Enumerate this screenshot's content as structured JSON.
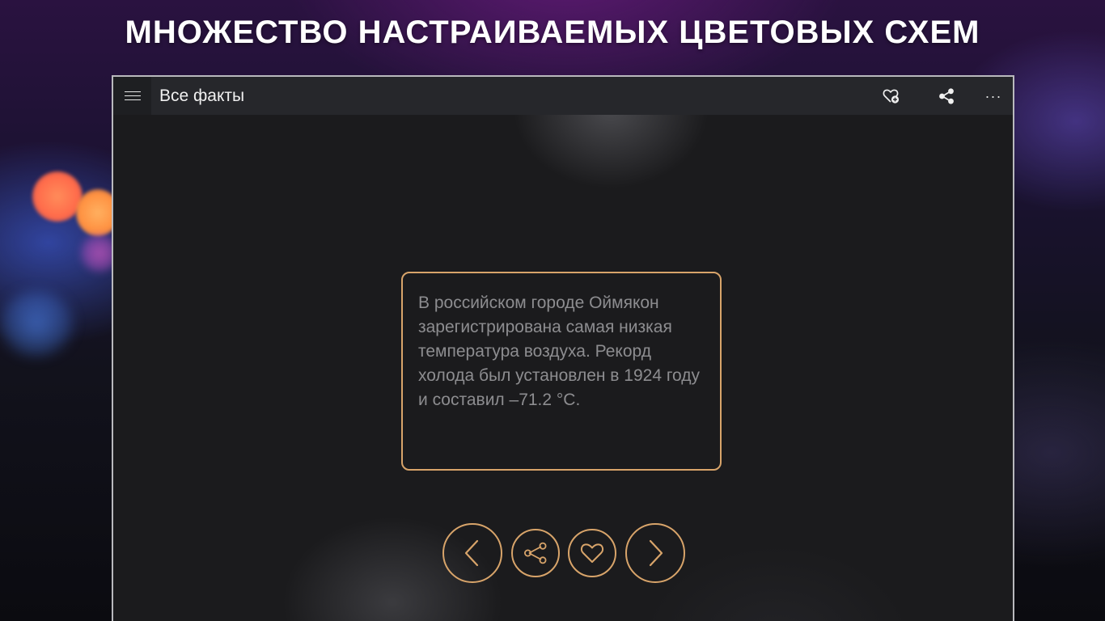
{
  "headline": "МНОЖЕСТВО НАСТРАИВАЕМЫХ ЦВЕТОВЫХ СХЕМ",
  "app": {
    "title": "Все факты",
    "more_label": "···"
  },
  "fact": {
    "text": "В российском городе Оймякон зарегистрирована самая низкая температура воздуха. Рекорд холода был установлен в 1924 году и составил –71.2 °C."
  },
  "icons": {
    "menu": "hamburger-icon",
    "favorites": "heart-list-icon",
    "share": "share-icon",
    "more": "more-icon",
    "prev": "chevron-left-icon",
    "share_fact": "share-icon",
    "like": "heart-icon",
    "next": "chevron-right-icon"
  },
  "colors": {
    "accent": "#d8a46a",
    "title_bar": "#26272b",
    "content_bg": "#1b1b1d",
    "fact_text": "#8d8d90"
  }
}
